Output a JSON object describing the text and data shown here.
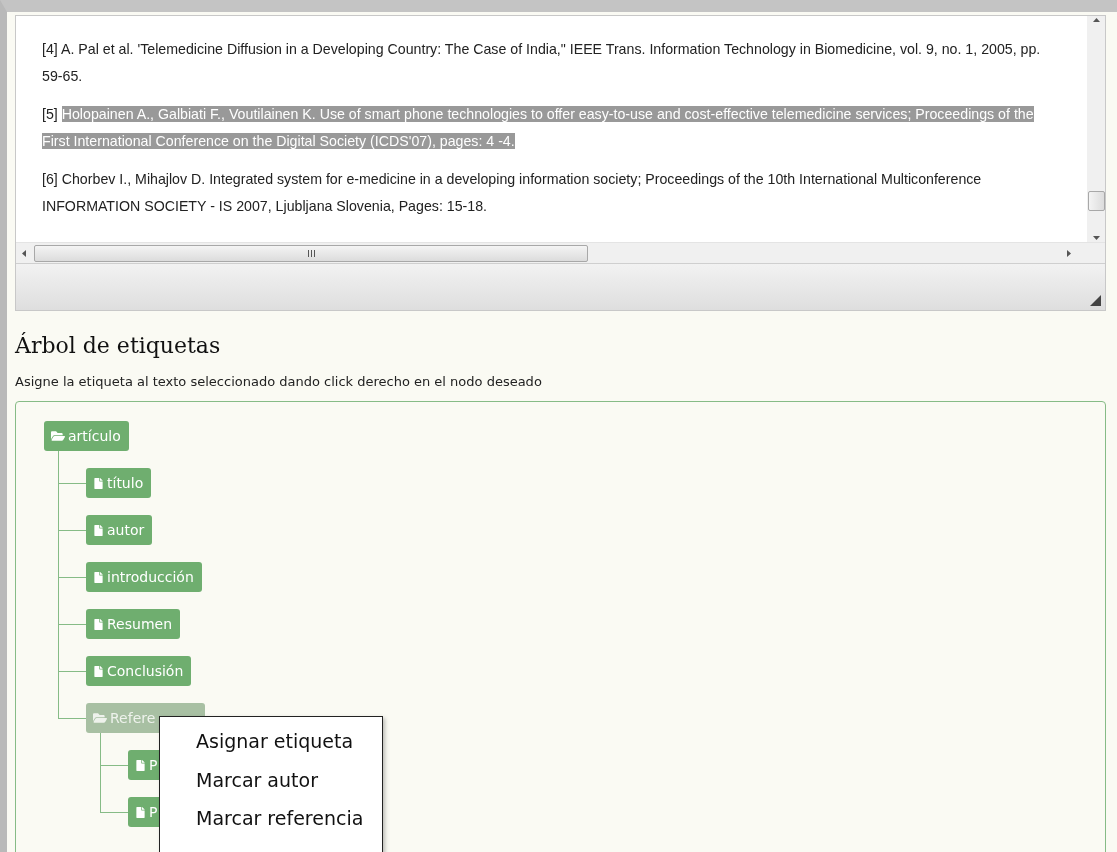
{
  "references": [
    {
      "label": "[4]",
      "text": "A. Pal et al. 'Telemedicine Diffusion in a Developing Country: The Case of India,\" IEEE Trans. Information Technology in Biomedicine, vol. 9, no. 1, 2005, pp. 59-65.",
      "highlighted": false
    },
    {
      "label": "[5]",
      "text": "Holopainen A., Galbiati F., Voutilainen K. Use of smart phone technologies to offer easy-to-use and cost-effective telemedicine services; Proceedings of the First International Conference on the Digital Society (ICDS'07), pages: 4 -4.",
      "highlighted": true
    },
    {
      "label": "[6]",
      "text": "Chorbev I., Mihajlov D. Integrated system for e-medicine in a developing information society; Proceedings of the 10th International Multiconference INFORMATION SOCIETY - IS 2007, Ljubljana Slovenia, Pages: 15-18.",
      "highlighted": false
    }
  ],
  "section": {
    "title": "Árbol de etiquetas",
    "instruction": "Asigne la etiqueta al texto seleccionado dando click derecho en el nodo deseado"
  },
  "tree": [
    {
      "label": "artículo",
      "kind": "folder",
      "selected": false,
      "children": [
        {
          "label": "título",
          "kind": "file",
          "selected": false
        },
        {
          "label": "autor",
          "kind": "file",
          "selected": false
        },
        {
          "label": "introducción",
          "kind": "file",
          "selected": false
        },
        {
          "label": "Resumen",
          "kind": "file",
          "selected": false
        },
        {
          "label": "Conclusión",
          "kind": "file",
          "selected": false
        },
        {
          "label": "Refere",
          "kind": "folder",
          "selected": true,
          "children": [
            {
              "label": "P",
              "kind": "file",
              "selected": false
            },
            {
              "label": "P",
              "kind": "file",
              "selected": false
            }
          ]
        }
      ]
    }
  ],
  "context_menu": [
    "Asignar etiqueta",
    "Marcar autor",
    "Marcar referencia"
  ]
}
